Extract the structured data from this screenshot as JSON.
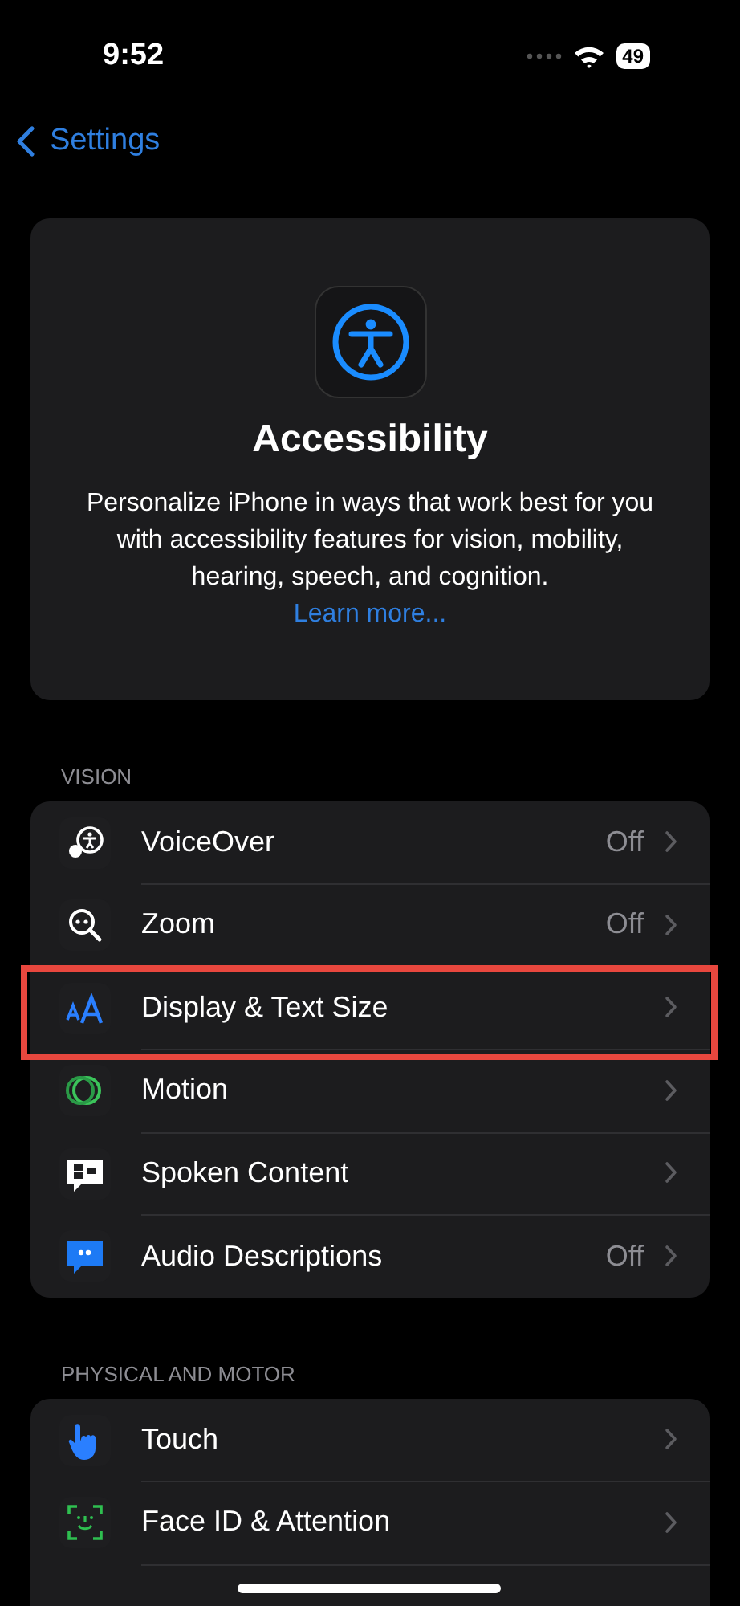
{
  "status_bar": {
    "time": "9:52",
    "battery": "49"
  },
  "nav": {
    "back": "Settings"
  },
  "header": {
    "title": "Accessibility",
    "description": "Personalize iPhone in ways that work best for you with accessibility features for vision, mobility, hearing, speech, and cognition.",
    "link": "Learn more..."
  },
  "sections": [
    {
      "title": "VISION",
      "rows": [
        {
          "label": "VoiceOver",
          "value": "Off",
          "highlighted": false
        },
        {
          "label": "Zoom",
          "value": "Off",
          "highlighted": false
        },
        {
          "label": "Display & Text Size",
          "highlighted": true
        },
        {
          "label": "Motion",
          "highlighted": false
        },
        {
          "label": "Spoken Content",
          "highlighted": false
        },
        {
          "label": "Audio Descriptions",
          "value": "Off",
          "highlighted": false
        }
      ]
    },
    {
      "title": "PHYSICAL AND MOTOR",
      "rows": [
        {
          "label": "Touch",
          "highlighted": false
        },
        {
          "label": "Face ID & Attention",
          "highlighted": false
        }
      ]
    }
  ]
}
